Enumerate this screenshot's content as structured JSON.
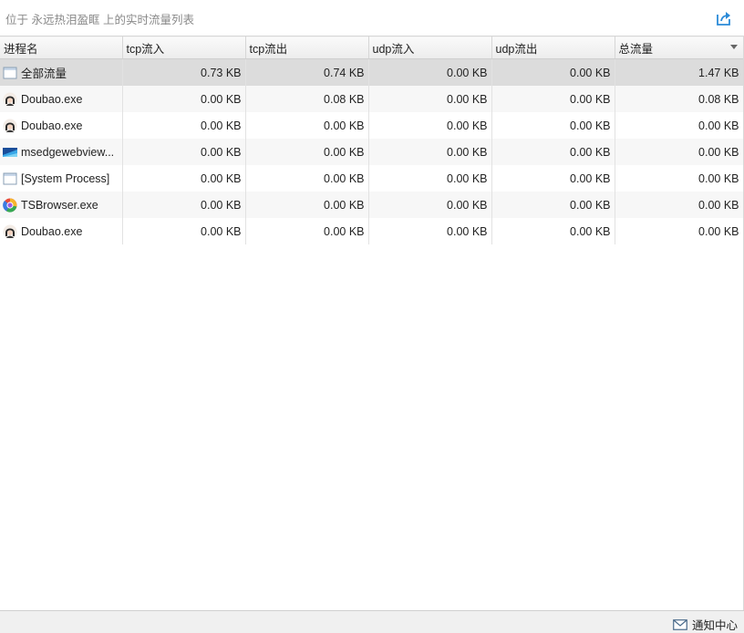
{
  "header": {
    "title": "位于 永远热泪盈眶 上的实时流量列表",
    "export_icon": "share-export-icon"
  },
  "table": {
    "columns": [
      "进程名",
      "tcp流入",
      "tcp流出",
      "udp流入",
      "udp流出",
      "总流量"
    ],
    "sorted_column": "总流量",
    "rows": [
      {
        "icon": "window-icon",
        "name": "全部流量",
        "tcp_in": "0.73 KB",
        "tcp_out": "0.74 KB",
        "udp_in": "0.00 KB",
        "udp_out": "0.00 KB",
        "total": "1.47 KB"
      },
      {
        "icon": "doubao-avatar-icon",
        "name": "Doubao.exe",
        "tcp_in": "0.00 KB",
        "tcp_out": "0.08 KB",
        "udp_in": "0.00 KB",
        "udp_out": "0.00 KB",
        "total": "0.08 KB"
      },
      {
        "icon": "doubao-avatar-icon",
        "name": "Doubao.exe",
        "tcp_in": "0.00 KB",
        "tcp_out": "0.00 KB",
        "udp_in": "0.00 KB",
        "udp_out": "0.00 KB",
        "total": "0.00 KB"
      },
      {
        "icon": "webview-icon",
        "name": "msedgewebview...",
        "tcp_in": "0.00 KB",
        "tcp_out": "0.00 KB",
        "udp_in": "0.00 KB",
        "udp_out": "0.00 KB",
        "total": "0.00 KB"
      },
      {
        "icon": "window-icon",
        "name": "[System Process]",
        "tcp_in": "0.00 KB",
        "tcp_out": "0.00 KB",
        "udp_in": "0.00 KB",
        "udp_out": "0.00 KB",
        "total": "0.00 KB"
      },
      {
        "icon": "tsbrowser-icon",
        "name": "TSBrowser.exe",
        "tcp_in": "0.00 KB",
        "tcp_out": "0.00 KB",
        "udp_in": "0.00 KB",
        "udp_out": "0.00 KB",
        "total": "0.00 KB"
      },
      {
        "icon": "doubao-avatar-icon",
        "name": "Doubao.exe",
        "tcp_in": "0.00 KB",
        "tcp_out": "0.00 KB",
        "udp_in": "0.00 KB",
        "udp_out": "0.00 KB",
        "total": "0.00 KB"
      }
    ]
  },
  "footer": {
    "notify_label": "通知中心",
    "notify_icon": "envelope-icon"
  },
  "colors": {
    "accent": "#2a8ad8",
    "selected_row": "#dcdcdc",
    "alt_row": "#f7f7f7"
  }
}
